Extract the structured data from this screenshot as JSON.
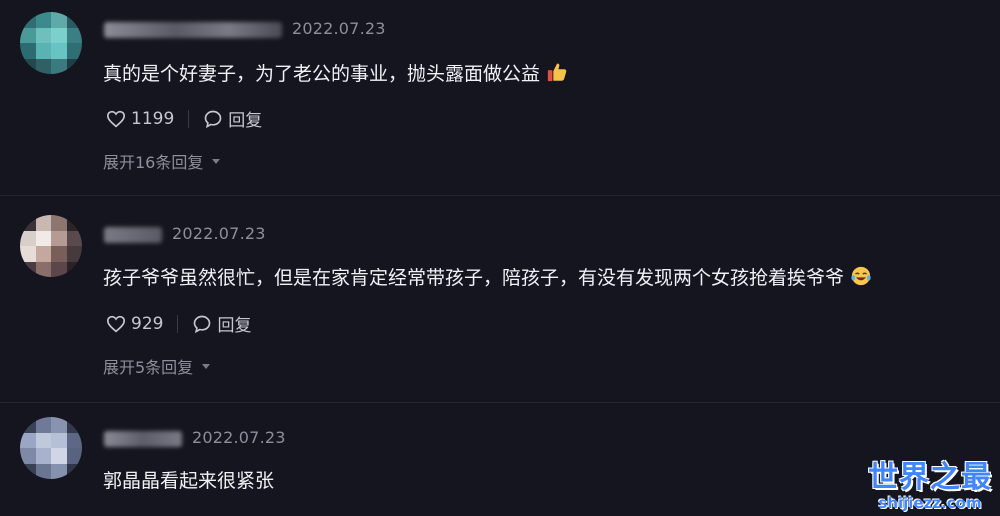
{
  "comments": [
    {
      "date": "2022.07.23",
      "text": "真的是个好妻子，为了老公的事业，抛头露面做公益",
      "emoji_icon": "thumbs-up-icon",
      "likes": "1199",
      "reply_label": "回复",
      "expand_label": "展开16条回复"
    },
    {
      "date": "2022.07.23",
      "text": "孩子爷爷虽然很忙，但是在家肯定经常带孩子，陪孩子，有没有发现两个女孩抢着挨爷爷",
      "emoji_icon": "laughing-tears-icon",
      "likes": "929",
      "reply_label": "回复",
      "expand_label": "展开5条回复"
    },
    {
      "date": "2022.07.23",
      "text": "郭晶晶看起来很紧张"
    }
  ],
  "watermark": {
    "title": "世界之最",
    "url": "shijiezz.com"
  },
  "colors": {
    "background": "#15151f",
    "watermark_blue": "#3f86ff",
    "secondary_text": "#8e8e9c"
  }
}
